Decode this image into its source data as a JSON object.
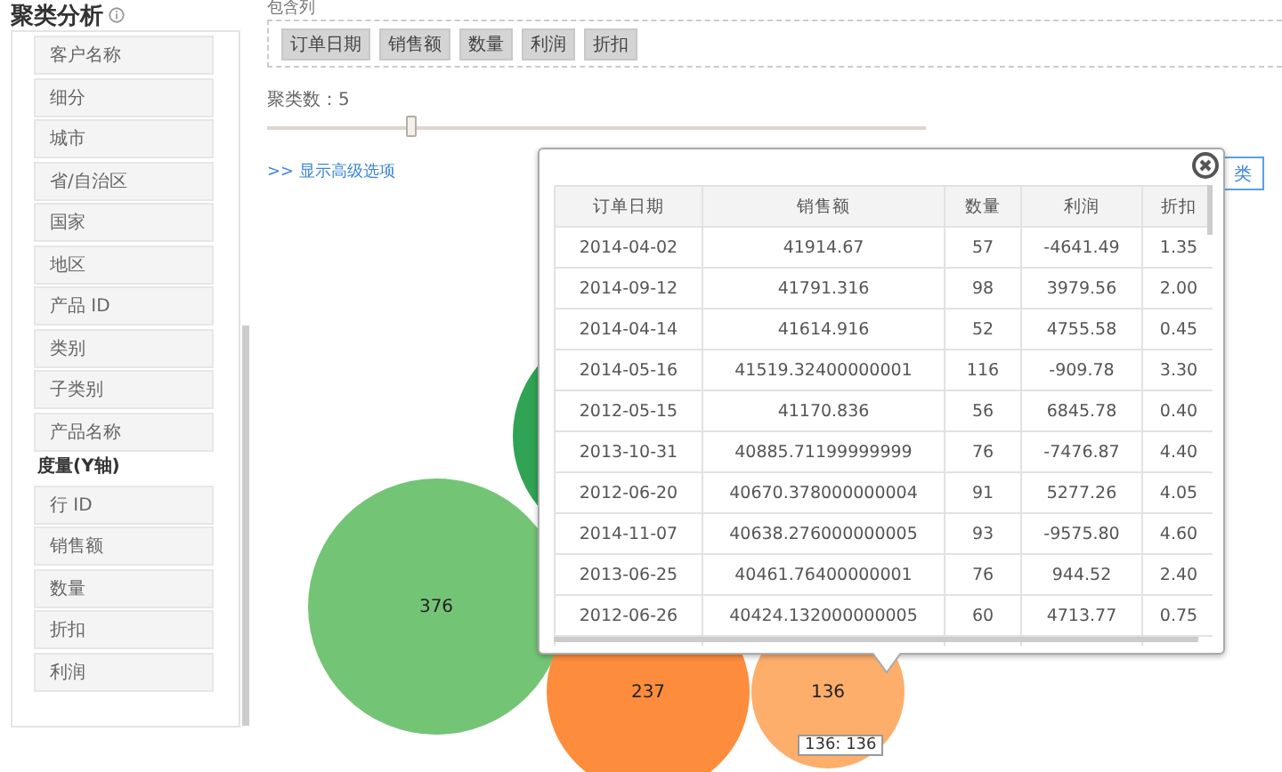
{
  "title": "聚类分析",
  "sidebar": {
    "items": [
      {
        "kind": "field",
        "label": "客户名称"
      },
      {
        "kind": "field",
        "label": "细分"
      },
      {
        "kind": "field",
        "label": "城市"
      },
      {
        "kind": "field",
        "label": "省/自治区"
      },
      {
        "kind": "field",
        "label": "国家"
      },
      {
        "kind": "field",
        "label": "地区"
      },
      {
        "kind": "field",
        "label": "产品 ID"
      },
      {
        "kind": "field",
        "label": "类别"
      },
      {
        "kind": "field",
        "label": "子类别"
      },
      {
        "kind": "field",
        "label": "产品名称"
      },
      {
        "kind": "group",
        "label": "度量(Y轴)"
      },
      {
        "kind": "field",
        "label": "行 ID"
      },
      {
        "kind": "field",
        "label": "销售额"
      },
      {
        "kind": "field",
        "label": "数量"
      },
      {
        "kind": "field",
        "label": "折扣"
      },
      {
        "kind": "field",
        "label": "利润"
      }
    ]
  },
  "included_columns": {
    "label": "包含列",
    "chips": [
      "订单日期",
      "销售额",
      "数量",
      "利润",
      "折扣"
    ]
  },
  "cluster_count": {
    "label": "聚类数：5",
    "level": 0.22
  },
  "advanced_link": ">> 显示高级选项",
  "run_button": "类",
  "bubbles": [
    {
      "label": "376",
      "color": "#74c476"
    },
    {
      "color": "#31a354"
    },
    {
      "label": "237",
      "color": "#fd8d3c"
    },
    {
      "label": "136",
      "color": "#fdae6b"
    }
  ],
  "tooltip": "136: 136",
  "popup": {
    "columns": [
      "订单日期",
      "销售额",
      "数量",
      "利润",
      "折扣"
    ],
    "rows": [
      [
        "2014-04-02",
        "41914.67",
        "57",
        "-4641.49",
        "1.35"
      ],
      [
        "2014-09-12",
        "41791.316",
        "98",
        "3979.56",
        "2.00"
      ],
      [
        "2014-04-14",
        "41614.916",
        "52",
        "4755.58",
        "0.45"
      ],
      [
        "2014-05-16",
        "41519.32400000001",
        "116",
        "-909.78",
        "3.30"
      ],
      [
        "2012-05-15",
        "41170.836",
        "56",
        "6845.78",
        "0.40"
      ],
      [
        "2013-10-31",
        "40885.71199999999",
        "76",
        "-7476.87",
        "4.40"
      ],
      [
        "2012-06-20",
        "40670.378000000004",
        "91",
        "5277.26",
        "4.05"
      ],
      [
        "2014-11-07",
        "40638.276000000005",
        "93",
        "-9575.80",
        "4.60"
      ],
      [
        "2013-06-25",
        "40461.76400000001",
        "76",
        "944.52",
        "2.40"
      ],
      [
        "2012-06-26",
        "40424.132000000005",
        "60",
        "4713.77",
        "0.75"
      ]
    ]
  }
}
